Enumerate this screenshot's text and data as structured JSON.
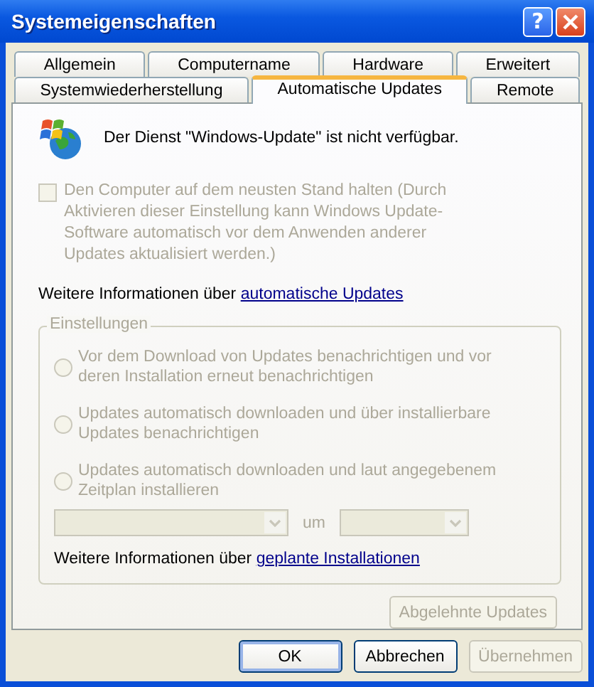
{
  "window": {
    "title": "Systemeigenschaften",
    "help": "?"
  },
  "tab_rows": [
    [
      {
        "label": "Allgemein",
        "selected": false
      },
      {
        "label": "Computername",
        "selected": false
      },
      {
        "label": "Hardware",
        "selected": false
      },
      {
        "label": "Erweitert",
        "selected": false
      }
    ],
    [
      {
        "label": "Systemwiederherstellung",
        "selected": false
      },
      {
        "label": "Automatische Updates",
        "selected": true
      },
      {
        "label": "Remote",
        "selected": false
      }
    ]
  ],
  "notice": "Der Dienst \"Windows-Update\" ist nicht verfügbar.",
  "keep_current": {
    "label": "Den Computer auf dem neusten Stand halten (Durch Aktivieren dieser Einstellung kann Windows Update-Software automatisch vor dem Anwenden anderer Updates aktualisiert werden.)",
    "checked": false,
    "disabled": true
  },
  "info": {
    "text": "Weitere Informationen über",
    "link": "automatische Updates"
  },
  "settings": {
    "title": "Einstellungen",
    "disabled": true,
    "options": [
      {
        "label": "Vor dem Download von Updates benachrichtigen und vor deren Installation erneut benachrichtigen",
        "selected": false
      },
      {
        "label": "Updates automatisch downloaden und über installierbare Updates benachrichtigen",
        "selected": false
      },
      {
        "label": "Updates automatisch downloaden und laut angegebenem Zeitplan installieren",
        "selected": false
      }
    ],
    "schedule": {
      "between": "um",
      "dropdowns": [
        {
          "disabled": true
        },
        {
          "disabled": true
        }
      ]
    },
    "info": {
      "text": "Weitere Informationen über",
      "link": "geplante Installationen"
    }
  },
  "declined_button": {
    "label": "Abgelehnte Updates",
    "disabled": true
  },
  "buttons": [
    {
      "label": "OK",
      "default": true,
      "disabled": false
    },
    {
      "label": "Abbrechen",
      "default": false,
      "disabled": false
    },
    {
      "label": "Übernehmen",
      "default": false,
      "disabled": true
    }
  ]
}
